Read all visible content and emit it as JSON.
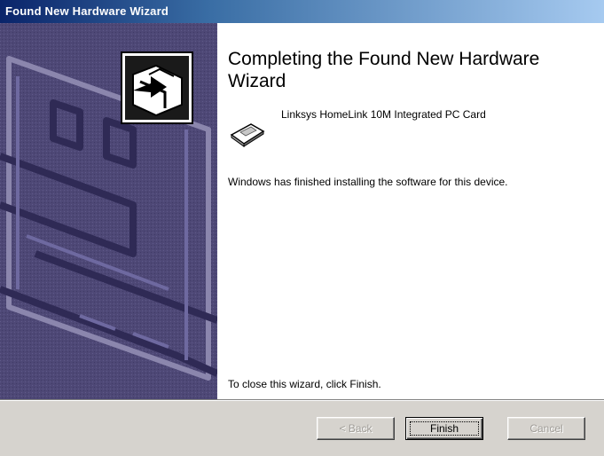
{
  "window": {
    "title": "Found New Hardware Wizard"
  },
  "main": {
    "heading": "Completing the Found New Hardware Wizard",
    "device": {
      "name": "Linksys HomeLink 10M Integrated PC Card",
      "icon": "network-card-icon"
    },
    "finished_message": "Windows has finished installing the software for this device.",
    "close_instruction": "To close this wizard, click Finish."
  },
  "sidebar_graphic": {
    "icon": "wizard-hardware-icon"
  },
  "buttons": {
    "back_label": "< Back",
    "finish_label": "Finish",
    "cancel_label": "Cancel"
  },
  "colors": {
    "titlebar_start": "#0a246a",
    "titlebar_end": "#a6caf0",
    "sidebar": "#4e4876",
    "dialog_face": "#d6d3ce"
  }
}
